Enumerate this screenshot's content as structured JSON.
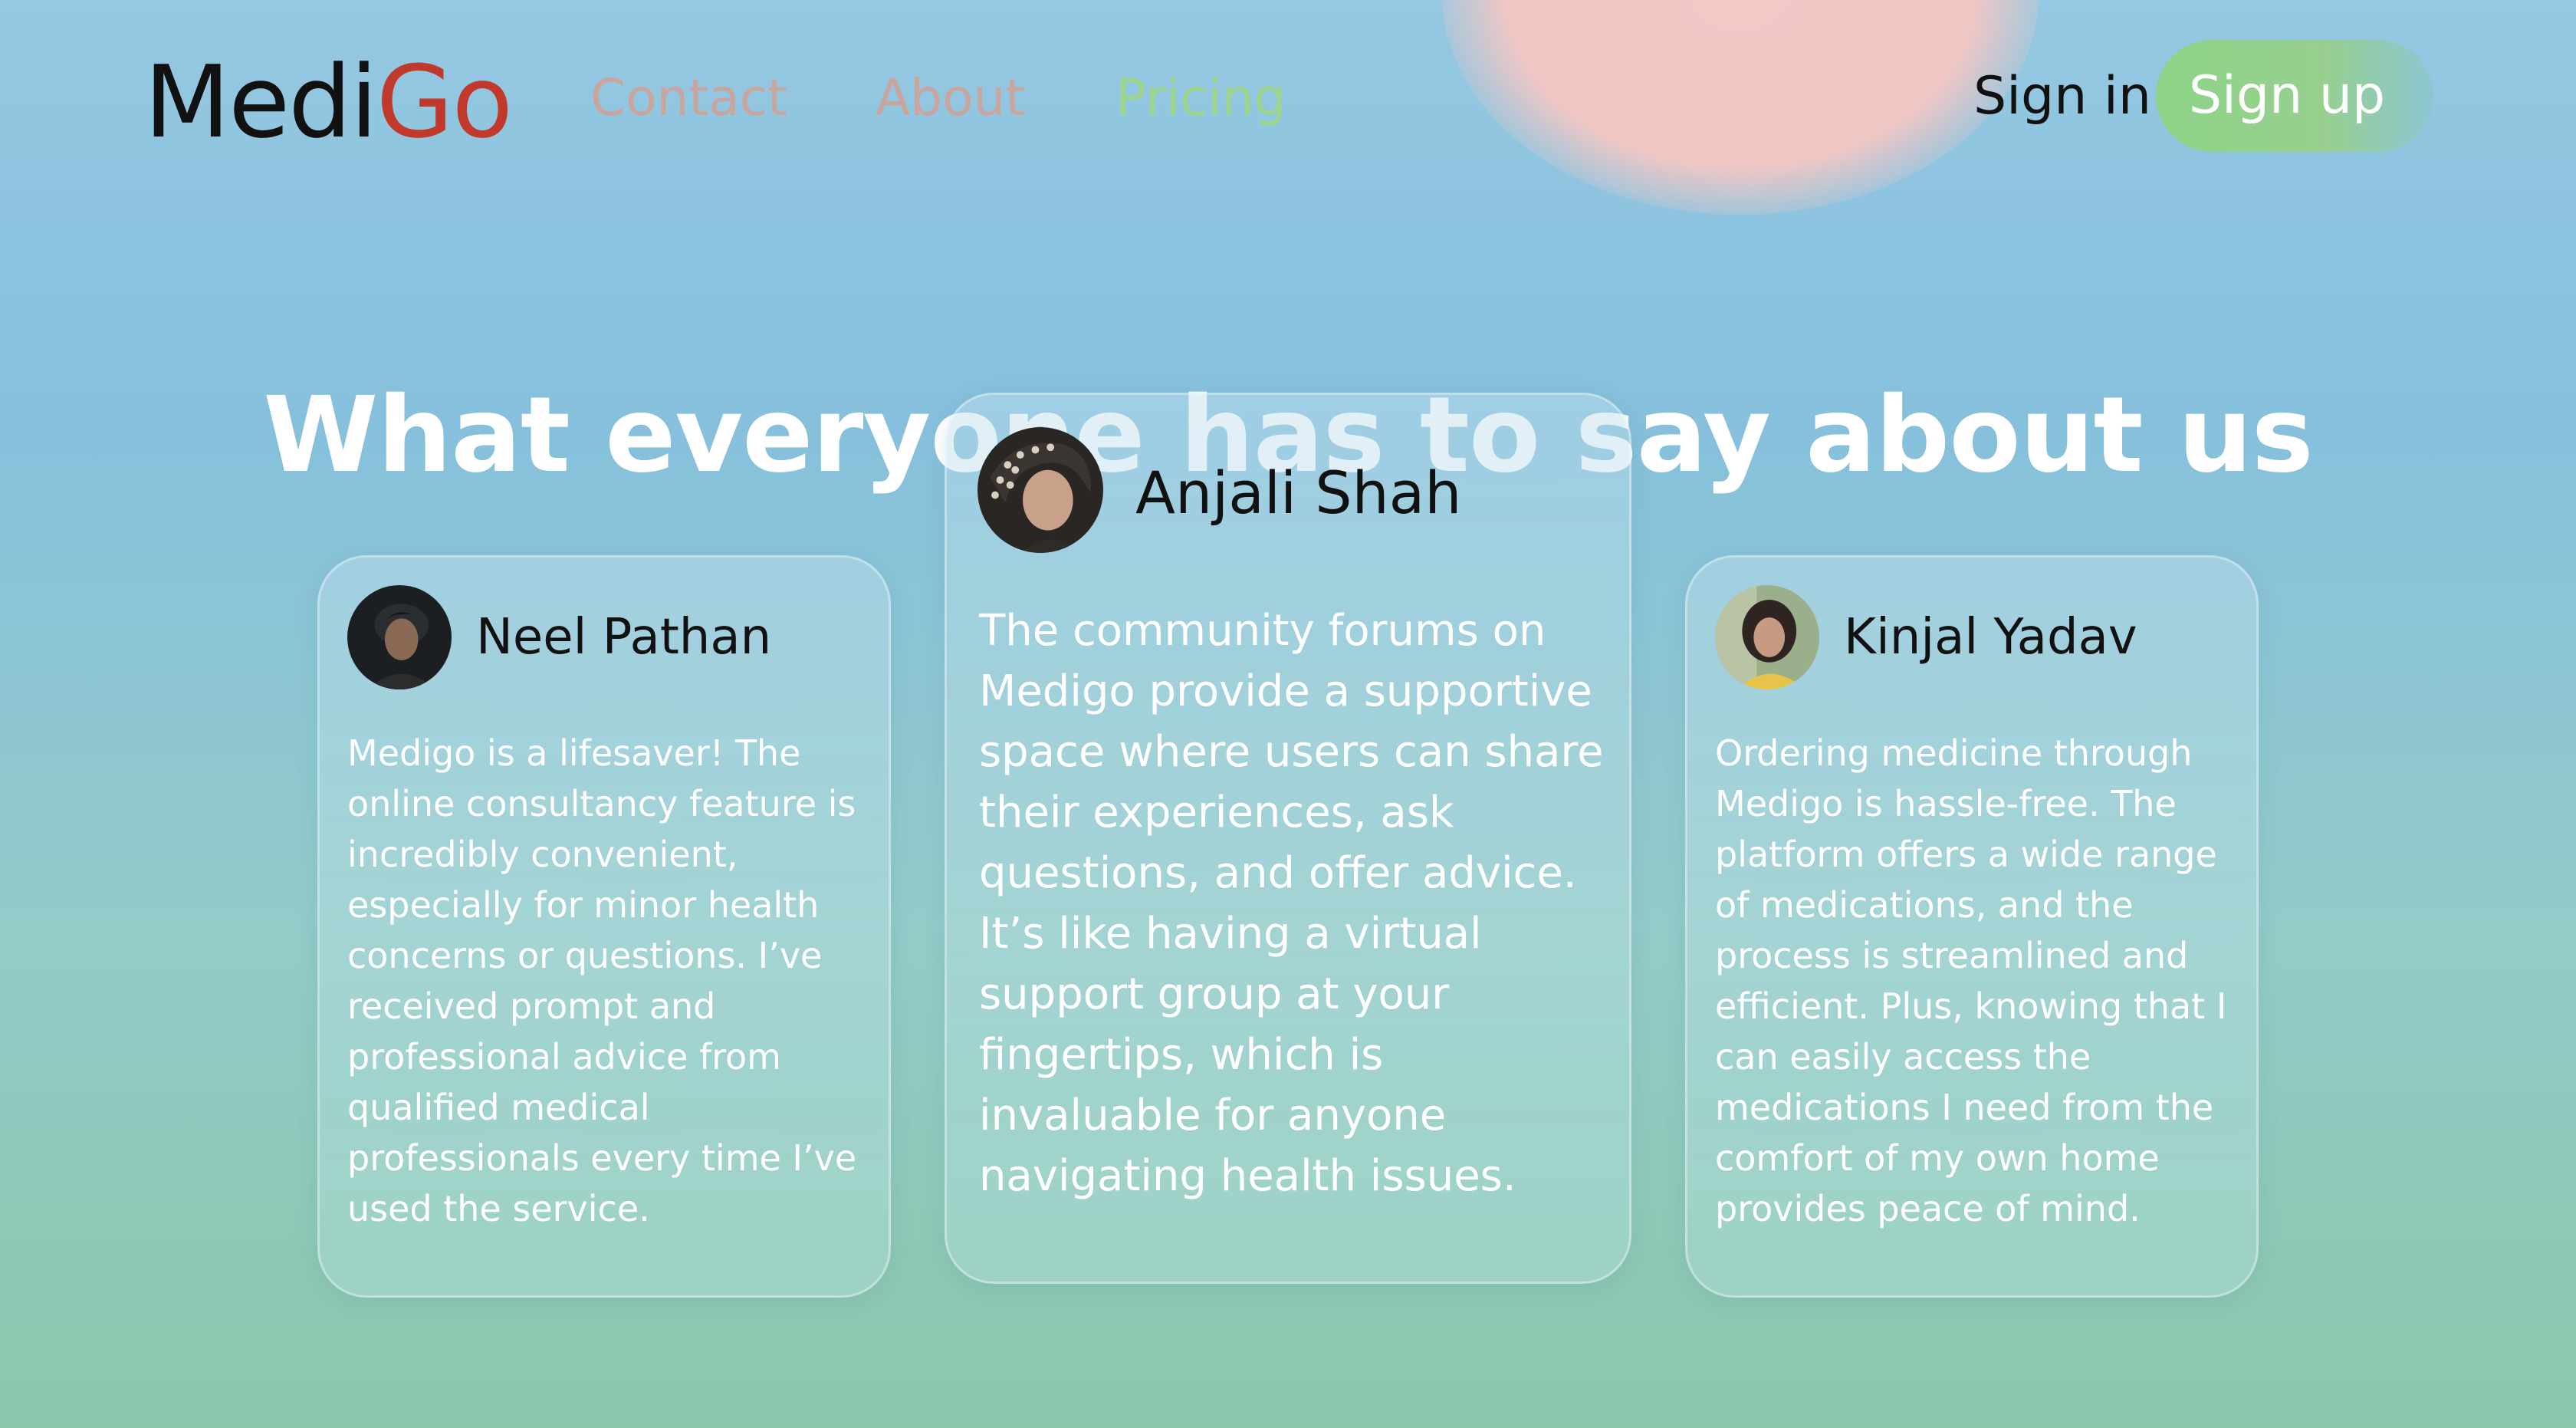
{
  "nav": {
    "logo_part1": "Medi",
    "logo_part2": "Go",
    "links": [
      "Contact",
      "About",
      "Pricing"
    ],
    "sign_in": "Sign in",
    "sign_up": "Sign up"
  },
  "section": {
    "title": "What everyone has to say about us"
  },
  "testimonials": [
    {
      "name": "Neel Pathan",
      "text": "Medigo is a lifesaver! The online consultancy feature is incredibly convenient, especially for minor health concerns or questions. I’ve received prompt and professional advice from qualified medical professionals every time I’ve used the service."
    },
    {
      "name": "Anjali Shah",
      "text": "The community forums on Medigo provide a supportive space where users can share their experiences, ask questions, and offer advice. It’s like having a virtual support group at your fingertips, which is invaluable for anyone navigating health issues."
    },
    {
      "name": "Kinjal Yadav",
      "text": "Ordering medicine through Medigo is hassle-free. The platform offers a wide range of medications, and the process is streamlined and efficient. Plus, knowing that I can easily access the medications I need from the comfort of my own home provides peace of mind."
    }
  ],
  "colors": {
    "logo_accent": "#c0392b",
    "nav_link": "#c9a59c",
    "nav_active": "#9fd48b",
    "signup_bg": "#8dd488"
  }
}
